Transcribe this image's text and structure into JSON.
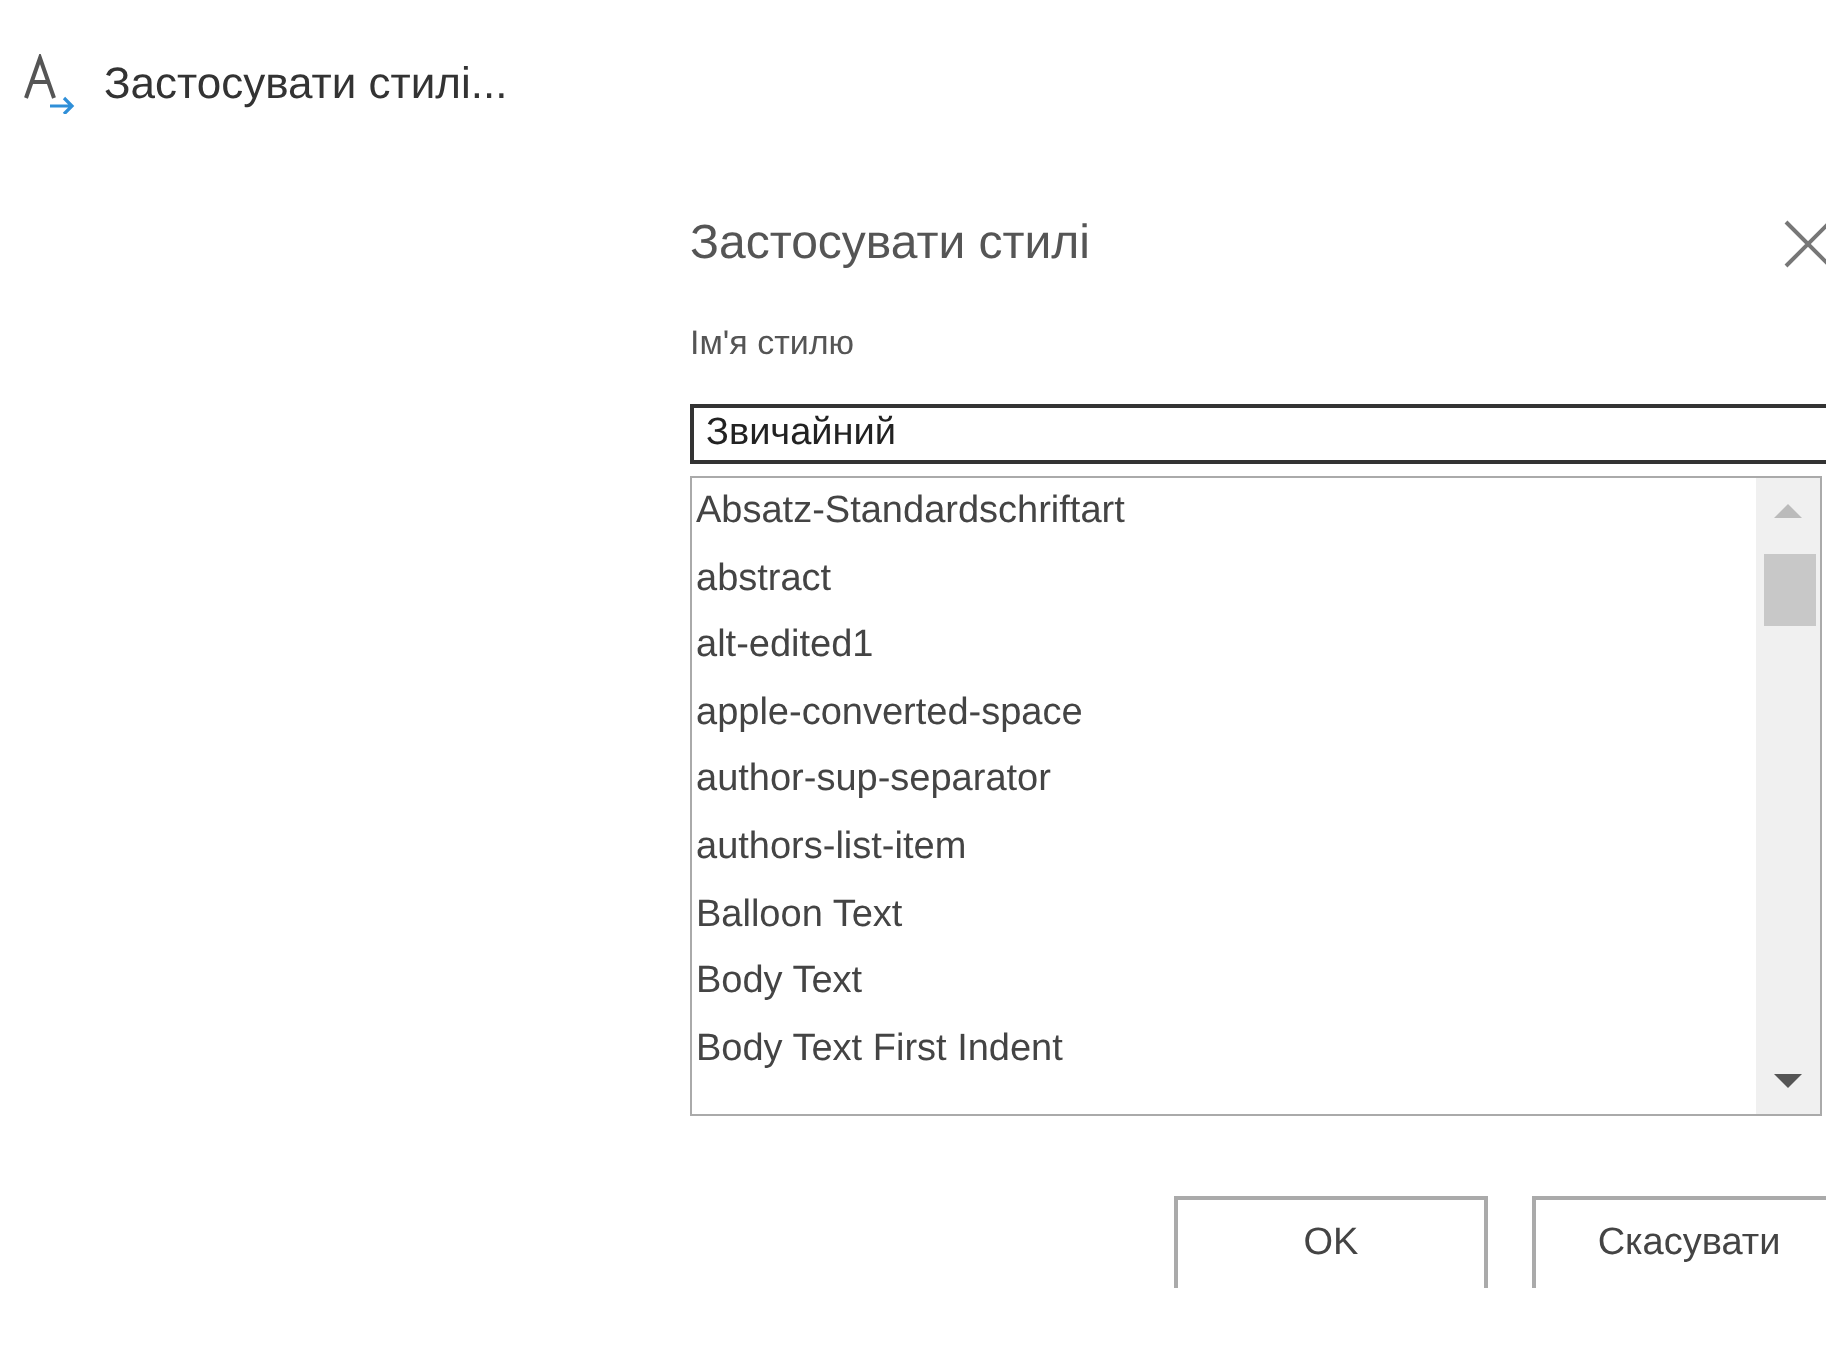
{
  "menu_item": {
    "label": "Застосувати стилі..."
  },
  "dialog": {
    "title": "Застосувати стилі",
    "field_label": "Ім'я стилю",
    "style_name": {
      "value": "Звичайний"
    },
    "styles": [
      {
        "label": "Absatz-Standardschriftart",
        "selected": false
      },
      {
        "label": "abstract",
        "selected": false
      },
      {
        "label": "alt-edited1",
        "selected": false
      },
      {
        "label": "apple-converted-space",
        "selected": false
      },
      {
        "label": "author-sup-separator",
        "selected": false
      },
      {
        "label": "authors-list-item",
        "selected": false
      },
      {
        "label": "Balloon Text",
        "selected": false
      },
      {
        "label": "Body Text",
        "selected": false
      },
      {
        "label": "Body Text First Indent",
        "selected": false
      }
    ],
    "buttons": [
      "OK",
      "Скасувати"
    ]
  }
}
